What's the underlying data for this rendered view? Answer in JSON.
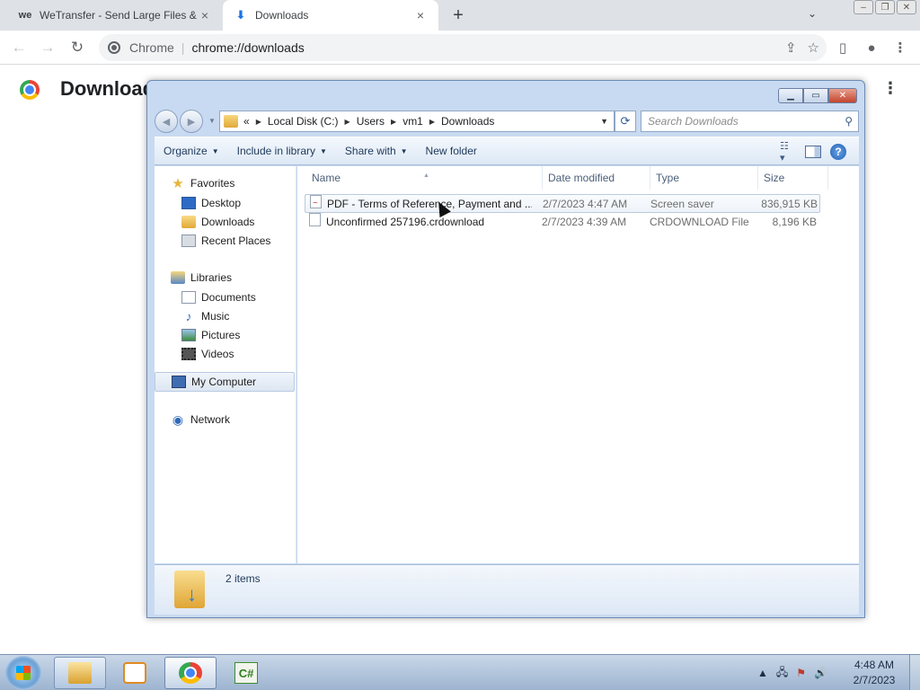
{
  "browser": {
    "tabs": [
      {
        "title": "WeTransfer - Send Large Files &",
        "favicon": "we",
        "active": false
      },
      {
        "title": "Downloads",
        "favicon": "download-icon",
        "active": true
      }
    ],
    "omnibox": {
      "site": "Chrome",
      "url": "chrome://downloads"
    },
    "page_title": "Downloads"
  },
  "explorer": {
    "breadcrumb": {
      "overflow": "«",
      "parts": [
        "Local Disk (C:)",
        "Users",
        "vm1",
        "Downloads"
      ]
    },
    "search_placeholder": "Search Downloads",
    "toolbar": {
      "organize": "Organize",
      "include_in_library": "Include in library",
      "share_with": "Share with",
      "new_folder": "New folder"
    },
    "nav": {
      "favorites": "Favorites",
      "favorites_items": [
        "Desktop",
        "Downloads",
        "Recent Places"
      ],
      "libraries": "Libraries",
      "libraries_items": [
        "Documents",
        "Music",
        "Pictures",
        "Videos"
      ],
      "computer": "My Computer",
      "network": "Network"
    },
    "columns": {
      "name": "Name",
      "date": "Date modified",
      "type": "Type",
      "size": "Size"
    },
    "files": [
      {
        "name": "PDF - Terms of Reference, Payment and ...",
        "date": "2/7/2023 4:47 AM",
        "type": "Screen saver",
        "size": "836,915 KB",
        "icon": "pdf-file-icon"
      },
      {
        "name": "Unconfirmed 257196.crdownload",
        "date": "2/7/2023 4:39 AM",
        "type": "CRDOWNLOAD File",
        "size": "8,196 KB",
        "icon": "blank-file-icon"
      }
    ],
    "status": "2 items"
  },
  "taskbar": {
    "clock_time": "4:48 AM",
    "clock_date": "2/7/2023",
    "tray_caret": "▲"
  }
}
